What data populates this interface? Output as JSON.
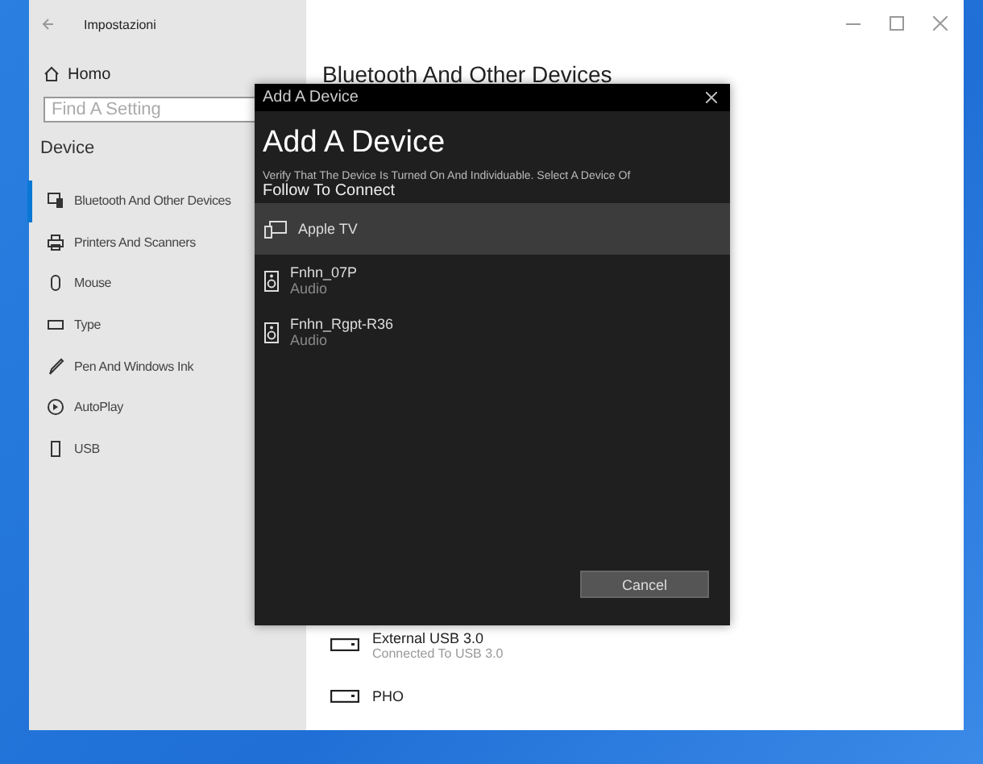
{
  "window": {
    "title": "Impostazioni"
  },
  "sidebar": {
    "home": "Homo",
    "search": {
      "placeholder": "Find A Setting"
    },
    "section": "Device",
    "items": [
      {
        "label": "Bluetooth And Other Devices",
        "kind": "bluetooth",
        "selected": true
      },
      {
        "label": "Printers And Scanners",
        "kind": "printer",
        "selected": false
      },
      {
        "label": "Mouse",
        "kind": "mouse",
        "selected": false
      },
      {
        "label": "Type",
        "kind": "keyboard",
        "selected": false
      },
      {
        "label": "Pen And Windows Ink",
        "kind": "pen",
        "selected": false
      },
      {
        "label": "AutoPlay",
        "kind": "autoplay",
        "selected": false
      },
      {
        "label": "USB",
        "kind": "usb",
        "selected": false
      }
    ]
  },
  "main": {
    "title": "Bluetooth And Other Devices",
    "devices": [
      {
        "name": "External USB 3.0",
        "status": "Connected To USB 3.0"
      },
      {
        "name": "PHO"
      }
    ]
  },
  "dialog": {
    "title": "Add A Device",
    "heading": "Add A Device",
    "description_line_1": "Verify That The Device Is Turned On And Individuable. Select A Device Of",
    "description_line_2": "Follow To Connect",
    "devices": [
      {
        "name": "Apple TV",
        "kind": "display",
        "selected": true
      },
      {
        "name": "Fnhn_07P",
        "type": "Audio",
        "kind": "speaker",
        "selected": false
      },
      {
        "name": "Fnhn_Rgpt-R36",
        "type": "Audio",
        "kind": "speaker",
        "selected": false
      }
    ],
    "cancel": "Cancel"
  }
}
